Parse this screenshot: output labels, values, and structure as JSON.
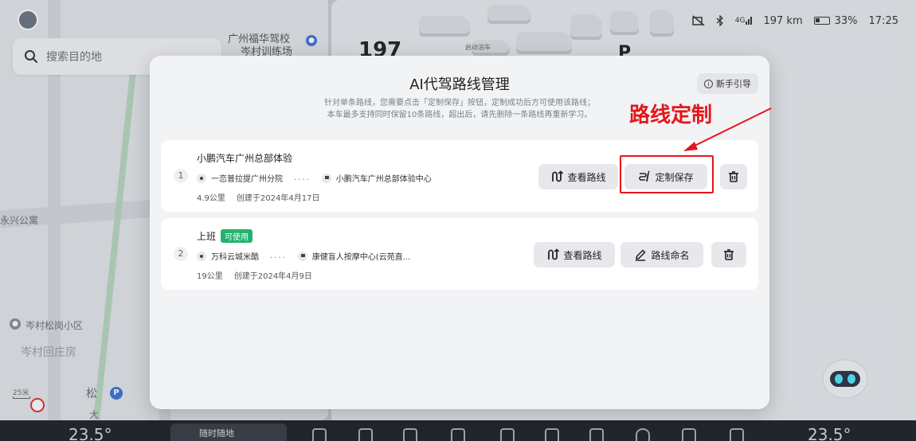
{
  "map": {
    "search_placeholder": "搜索目的地",
    "label_school": "广州福华驾校",
    "label_school2": "岑村训练场",
    "label_yongxing": "永兴公寓",
    "label_songgang": "岑村松岗小区",
    "label_huizhuang": "岑村回庄房",
    "label_song": "松",
    "label_da": "大",
    "scale": "25米",
    "speed_partial": "197",
    "p_letter": "P",
    "parking_text": "启动泊车"
  },
  "status_bar": {
    "signal": "4G",
    "range": "197 km",
    "battery": "33%",
    "time": "17:25"
  },
  "dock": {
    "temp_left": "23.5°",
    "temp_right": "23.5°",
    "media_label": "随时随地"
  },
  "modal": {
    "title": "AI代驾路线管理",
    "desc_line1": "针对单条路线，您需要点击「定制保存」按钮，定制成功后方可使用该路线；",
    "desc_line2": "本车最多支持同时保留10条路线，超出后，请先删除一条路线再重新学习。",
    "guide_label": "新手引导",
    "routes": [
      {
        "index": "1",
        "name": "小鹏汽车广州总部体验",
        "badge": "",
        "from": "一恋普拉提广州分院",
        "to": "小鹏汽车广州总部体验中心",
        "dots": "....",
        "distance": "4.9公里",
        "created": "创建于2024年4月17日",
        "btn_view": "查看路线",
        "btn_action": "定制保存"
      },
      {
        "index": "2",
        "name": "上班",
        "badge": "可使用",
        "from": "万科云城米酷",
        "to": "康健盲人按摩中心(云苑直...",
        "dots": "....",
        "distance": "19公里",
        "created": "创建于2024年4月9日",
        "btn_view": "查看路线",
        "btn_action": "路线命名"
      }
    ]
  },
  "annotation": {
    "text": "路线定制",
    "color": "#e5161b"
  },
  "colors": {
    "badge_green": "#23b26d",
    "modal_bg": "#f2f3f5",
    "button_bg": "#e6e8ec"
  }
}
